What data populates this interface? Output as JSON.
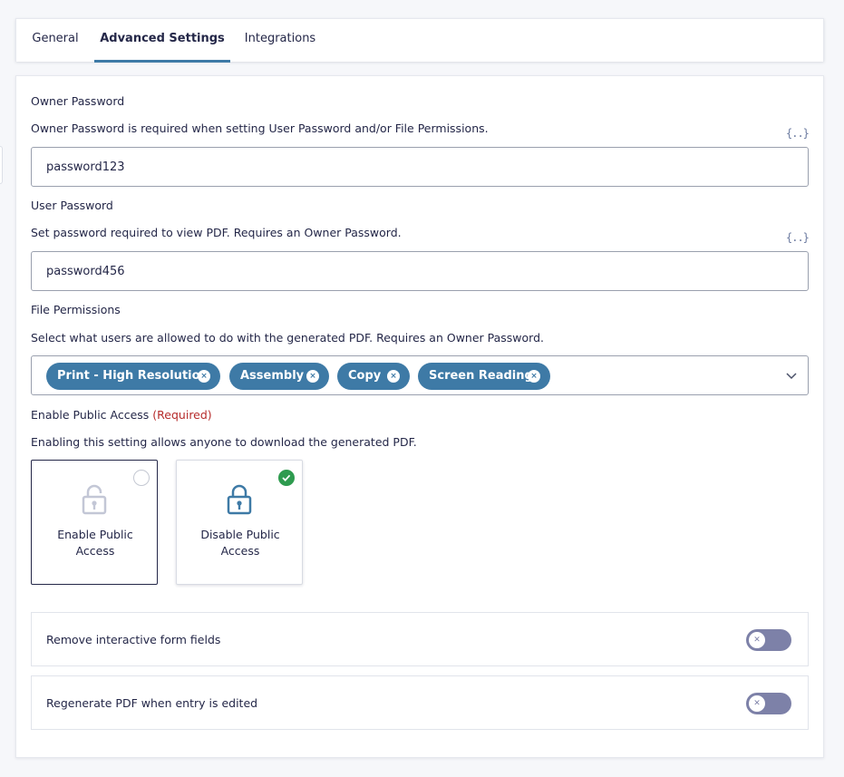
{
  "tabs": [
    {
      "label": "General"
    },
    {
      "label": "Advanced Settings"
    },
    {
      "label": "Integrations"
    }
  ],
  "owner_password": {
    "label": "Owner Password",
    "description": "Owner Password is required when setting User Password and/or File Permissions.",
    "value": "password123",
    "merge_icon": "{..}"
  },
  "user_password": {
    "label": "User Password",
    "description": "Set password required to view PDF. Requires an Owner Password.",
    "value": "password456",
    "merge_icon": "{..}"
  },
  "file_permissions": {
    "label": "File Permissions",
    "description": "Select what users are allowed to do with the generated PDF. Requires an Owner Password.",
    "selected": [
      "Print - High Resolution",
      "Assembly",
      "Copy",
      "Screen Reading"
    ],
    "remove_glyph": "×"
  },
  "public_access": {
    "label": "Enable Public Access",
    "required": "(Required)",
    "description": "Enabling this setting allows anyone to download the generated PDF.",
    "options": [
      {
        "label": "Enable Public Access",
        "icon": "unlocked-padlock-icon",
        "selected": false
      },
      {
        "label": "Disable Public Access",
        "icon": "locked-padlock-icon",
        "selected": true
      }
    ]
  },
  "toggles": [
    {
      "label": "Remove interactive form fields",
      "on": false
    },
    {
      "label": "Regenerate PDF when entry is edited",
      "on": false
    }
  ],
  "colors": {
    "accent": "#3e7aa6",
    "success": "#2e9b4f",
    "required": "#b62b2b",
    "toggle_off": "#7d81a8"
  }
}
